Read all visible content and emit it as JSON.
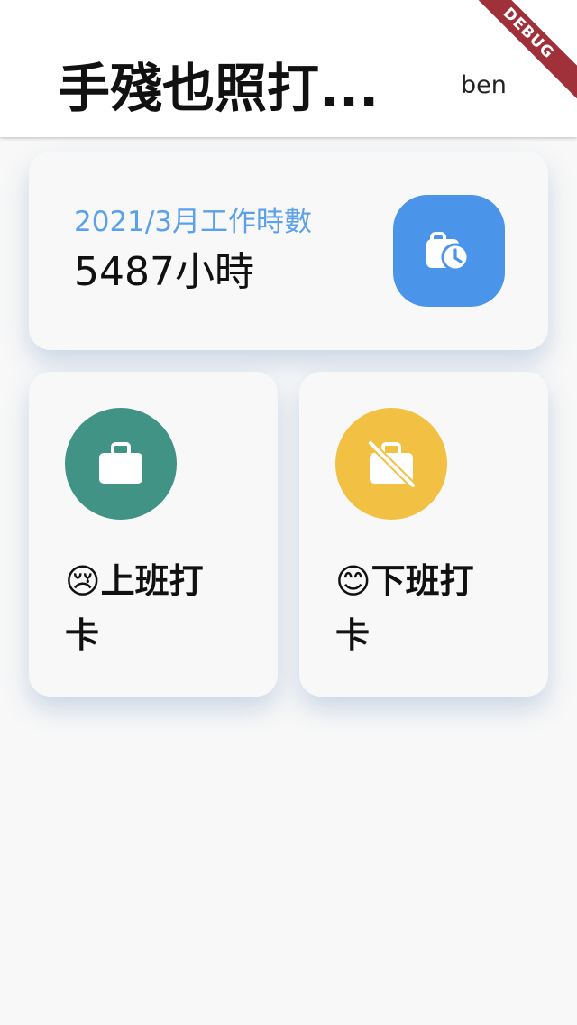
{
  "app_bar": {
    "title": "手殘也照打...",
    "user": "ben",
    "debug_banner": "DEBUG"
  },
  "hours_card": {
    "label": "2021/3月工作時數",
    "value": "5487小時",
    "icon": "work-history-icon",
    "accent_color": "#4a95ea"
  },
  "punch_in": {
    "label": "😢上班打卡",
    "icon": "briefcase-icon",
    "color": "#419385"
  },
  "punch_out": {
    "label": "😊下班打卡",
    "icon": "briefcase-off-icon",
    "color": "#f2c043"
  }
}
